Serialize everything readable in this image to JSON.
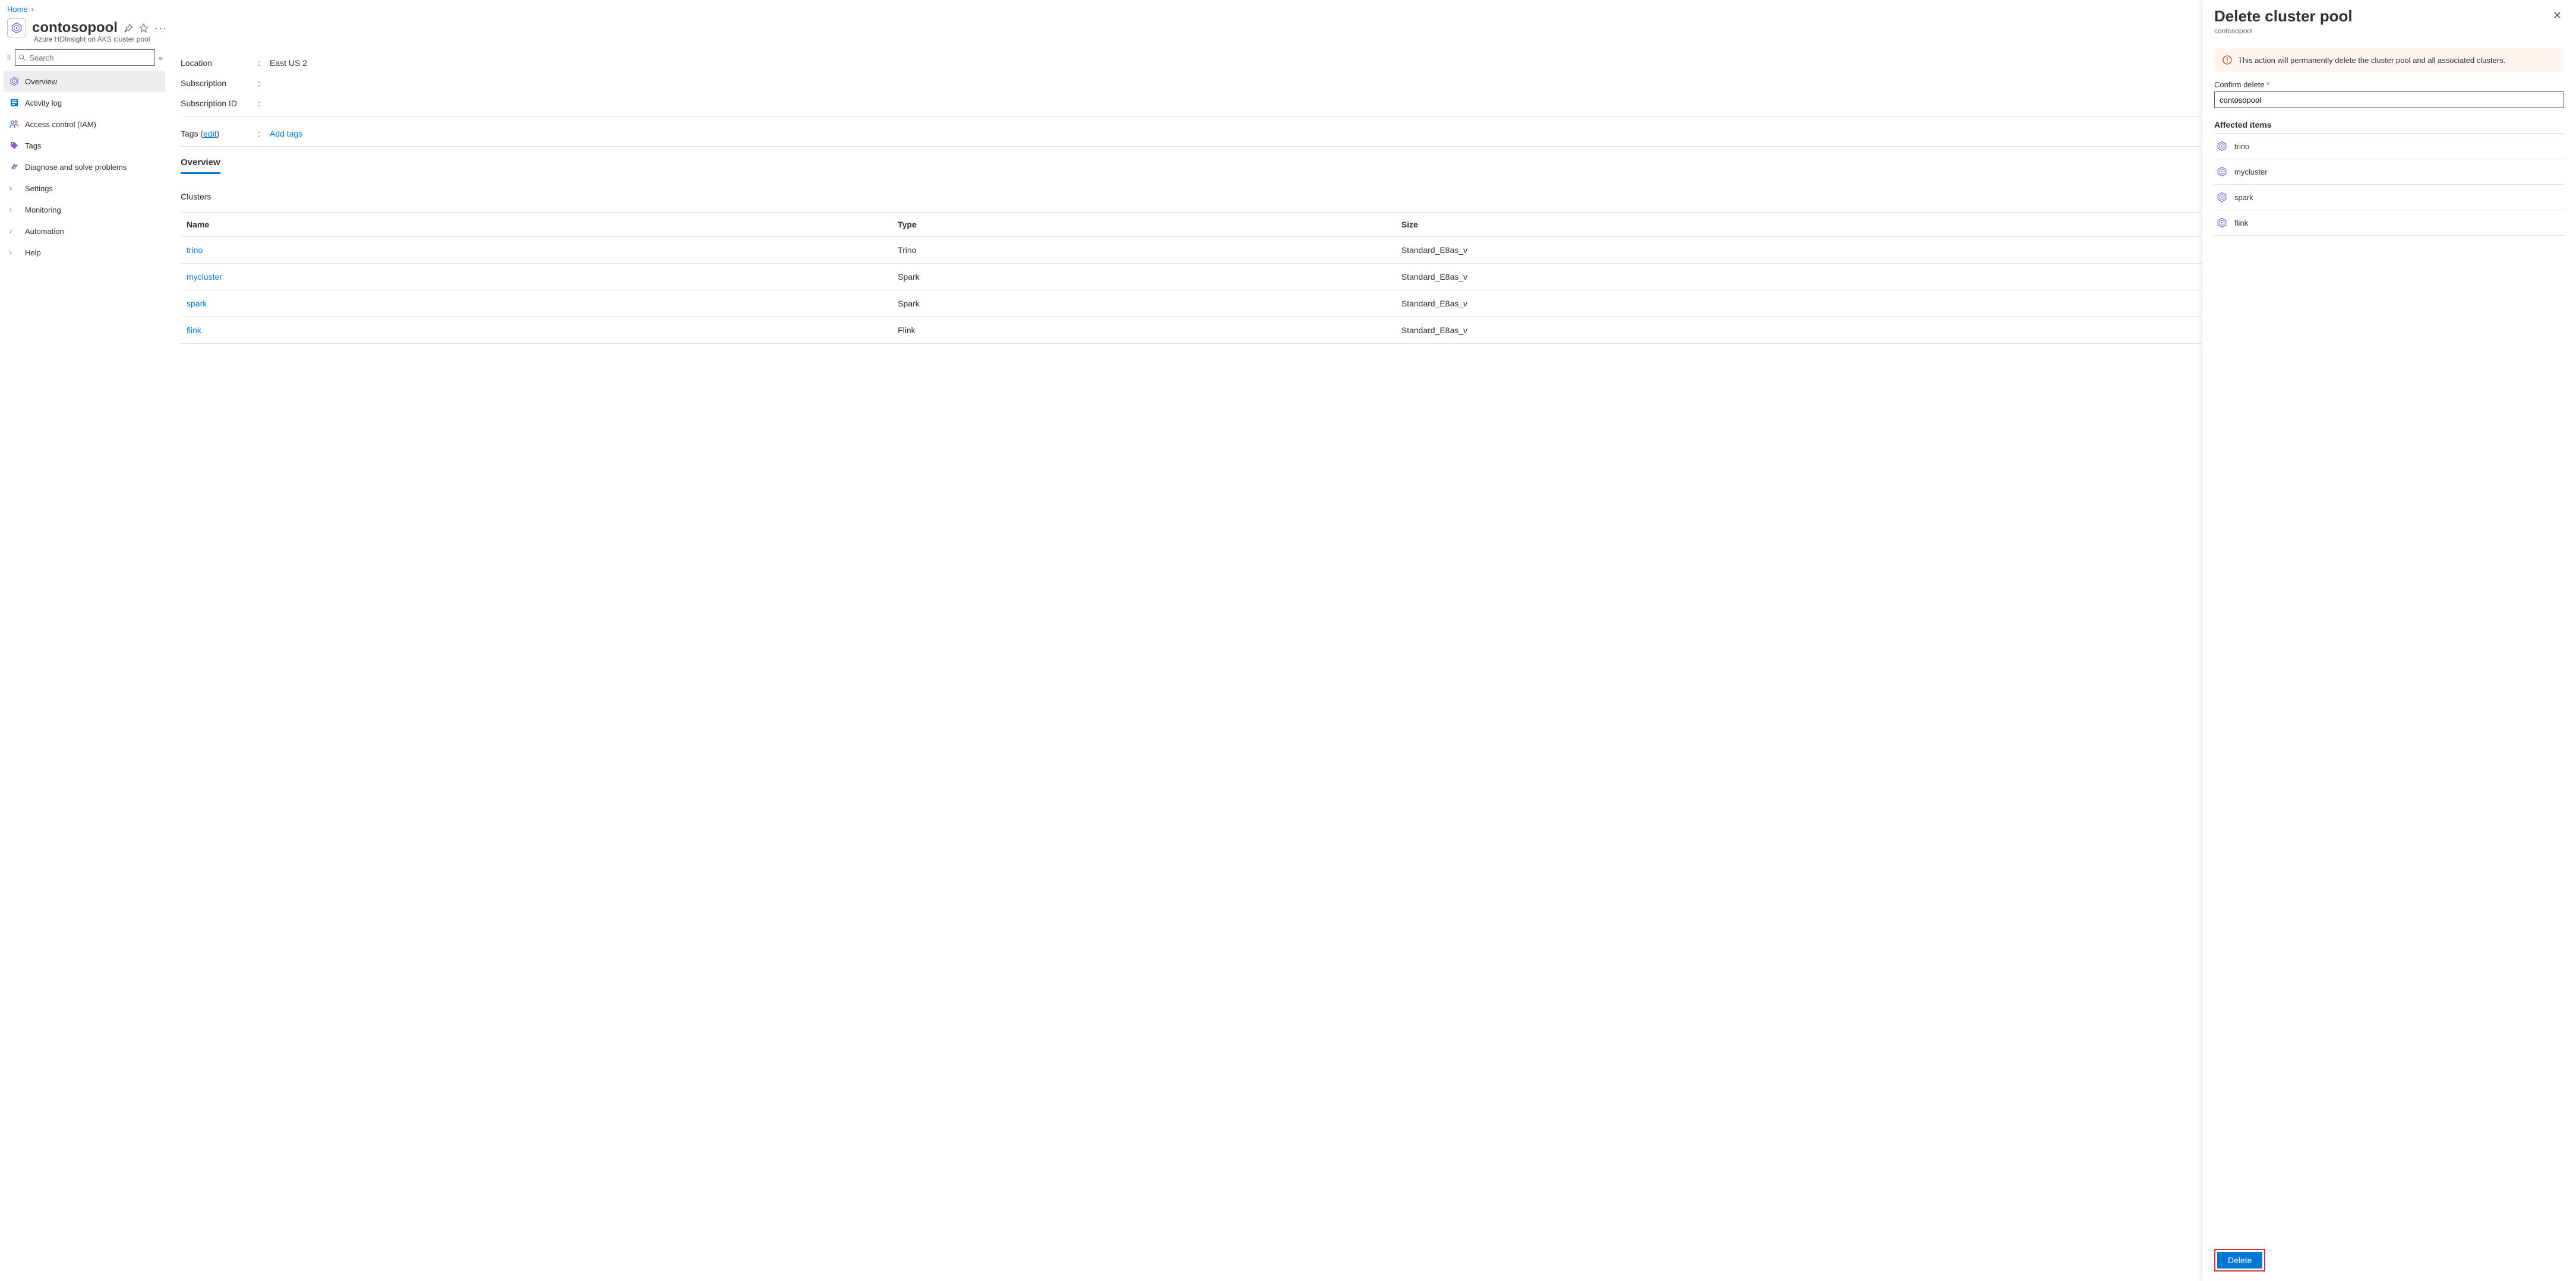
{
  "breadcrumb": {
    "home": "Home"
  },
  "header": {
    "title": "contosopool",
    "subtitle": "Azure HDInsight on AKS cluster pool"
  },
  "sidebar": {
    "search_placeholder": "Search",
    "items": [
      {
        "label": "Overview"
      },
      {
        "label": "Activity log"
      },
      {
        "label": "Access control (IAM)"
      },
      {
        "label": "Tags"
      },
      {
        "label": "Diagnose and solve problems"
      },
      {
        "label": "Settings"
      },
      {
        "label": "Monitoring"
      },
      {
        "label": "Automation"
      },
      {
        "label": "Help"
      }
    ]
  },
  "properties": {
    "location_lbl": "Location",
    "location_val": "East US 2",
    "subscription_lbl": "Subscription",
    "subscription_id_lbl": "Subscription ID",
    "tags_lbl": "Tags",
    "tags_edit": "edit",
    "add_tags": "Add tags"
  },
  "tabs": {
    "overview": "Overview"
  },
  "clusters_section": "Clusters",
  "table": {
    "headers": {
      "name": "Name",
      "type": "Type",
      "size": "Size"
    },
    "rows": [
      {
        "name": "trino",
        "type": "Trino",
        "size": "Standard_E8as_v"
      },
      {
        "name": "mycluster",
        "type": "Spark",
        "size": "Standard_E8as_v"
      },
      {
        "name": "spark",
        "type": "Spark",
        "size": "Standard_E8as_v"
      },
      {
        "name": "flink",
        "type": "Flink",
        "size": "Standard_E8as_v"
      }
    ]
  },
  "blade": {
    "title": "Delete cluster pool",
    "subtitle": "contosopool",
    "warning": "This action will permanently delete the cluster pool and all associated clusters.",
    "confirm_label": "Confirm delete",
    "confirm_value": "contosopool",
    "affected_title": "Affected items",
    "affected": [
      {
        "name": "trino"
      },
      {
        "name": "mycluster"
      },
      {
        "name": "spark"
      },
      {
        "name": "flink"
      }
    ],
    "delete_btn": "Delete"
  }
}
